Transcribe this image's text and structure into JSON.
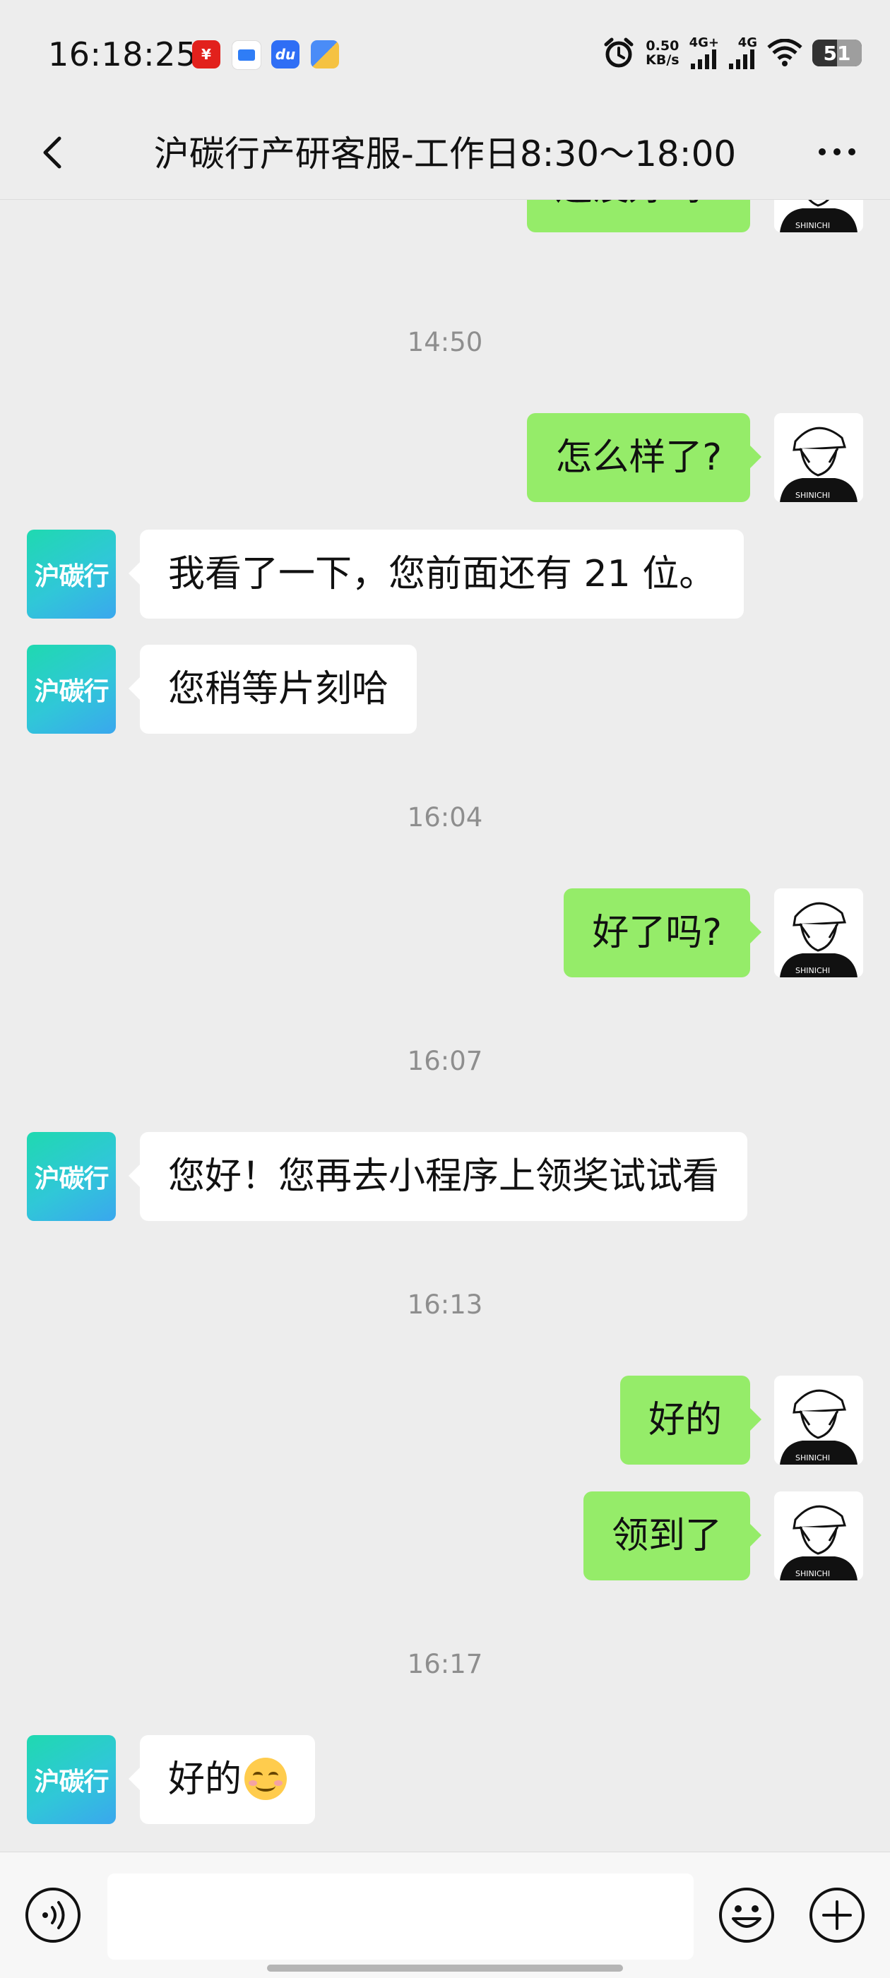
{
  "status_bar": {
    "time": "16:18:25",
    "notification_icons": [
      "bank-app-icon",
      "message-app-icon",
      "baidu-app-icon",
      "files-app-icon"
    ],
    "network_speed_value": "0.50",
    "network_speed_unit": "KB/s",
    "sim1_label": "4G+",
    "sim2_label": "4G",
    "battery": "51"
  },
  "header": {
    "title": "沪碳行产研客服-工作日8:30～18:00"
  },
  "bot_avatar_text": "沪碳行",
  "messages": [
    {
      "type": "out",
      "text": "还没好吗?"
    },
    {
      "type": "time",
      "text": "14:50"
    },
    {
      "type": "out",
      "text": "怎么样了?"
    },
    {
      "type": "in",
      "text": "我看了一下，您前面还有 21 位。"
    },
    {
      "type": "in",
      "text": "您稍等片刻哈"
    },
    {
      "type": "time",
      "text": "16:04"
    },
    {
      "type": "out",
      "text": "好了吗?"
    },
    {
      "type": "time",
      "text": "16:07"
    },
    {
      "type": "in",
      "text": "您好！您再去小程序上领奖试试看"
    },
    {
      "type": "time",
      "text": "16:13"
    },
    {
      "type": "out",
      "text": "好的"
    },
    {
      "type": "out",
      "text": "领到了"
    },
    {
      "type": "time",
      "text": "16:17"
    },
    {
      "type": "in",
      "text": "好的",
      "emoji": "smiling-face-emoji"
    }
  ],
  "input_bar": {
    "text_value": "",
    "icons": [
      "voice-icon",
      "emoji-icon",
      "plus-icon"
    ]
  },
  "colors": {
    "background": "#ededed",
    "outgoing_bubble": "#95ec69",
    "incoming_bubble": "#ffffff",
    "timestamp": "#8e8e8e"
  }
}
